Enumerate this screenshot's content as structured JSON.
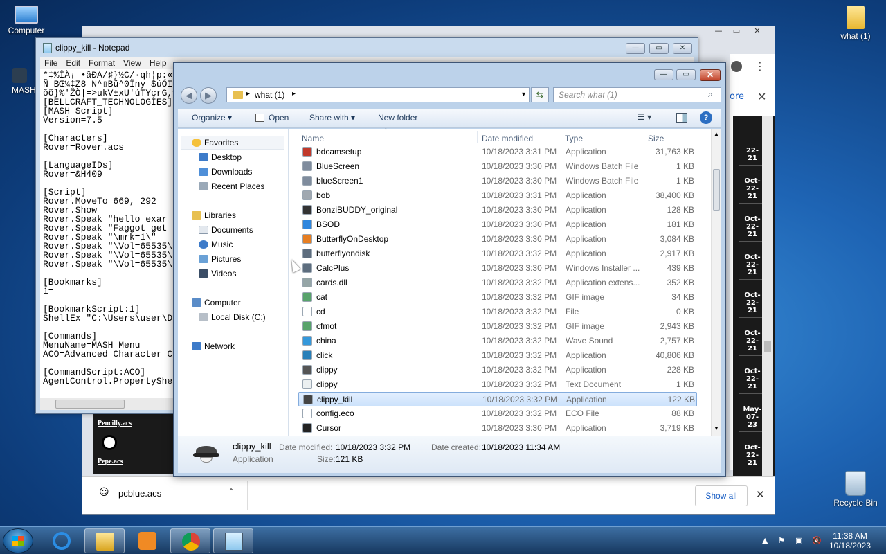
{
  "desktop": {
    "icons": [
      {
        "label": "Computer"
      },
      {
        "label": "MASH"
      },
      {
        "label": "what (1)"
      },
      {
        "label": "Recycle Bin"
      }
    ]
  },
  "browser": {
    "link_text": "ore",
    "dates": [
      "22-\n21",
      "Oct-\n22-\n21",
      "Oct-\n22-\n21",
      "Oct-\n22-\n21",
      "Oct-\n22-\n21",
      "Oct-\n22-\n21",
      "Oct-\n22-\n21",
      "May-\n07-\n23",
      "Oct-\n22-\n21"
    ],
    "acs_items": [
      "Pencilly.acs",
      "Pepe.acs"
    ],
    "download": {
      "filename": "pcblue.acs",
      "show_all": "Show all"
    }
  },
  "notepad": {
    "title": "clippy_kill - Notepad",
    "menu": [
      "File",
      "Edit",
      "Format",
      "View",
      "Help"
    ],
    "lines": [
      "*‡%ÎÀ¡—•âÐA/♯}½C/·qh¦p:«0",
      "Ñ–BŒ¼‡Z8 N^▯Bü^0Ïny $úÓI",
      "ŏõ}%'ŽÒ|=>ukV±xU'úTYçrG,€",
      "[BELLCRAFT_TECHNOLOGIES]",
      "[MASH Script]",
      "Version=7.5",
      "",
      "[Characters]",
      "Rover=Rover.acs",
      "",
      "[LanguageIDs]",
      "Rover=&H409",
      "",
      "[Script]",
      "Rover.MoveTo 669, 292",
      "Rover.Show",
      "Rover.Speak \"hello exar",
      "Rover.Speak \"Faggot get",
      "Rover.Speak \"\\mrk=1\\\"",
      "Rover.Speak \"\\Vol=65535\\",
      "Rover.Speak \"\\Vol=65535\\",
      "Rover.Speak \"\\Vol=65535\\",
      "",
      "[Bookmarks]",
      "1=",
      "",
      "[BookmarkScript:1]",
      "ShellEx \"C:\\Users\\user\\D",
      "",
      "[Commands]",
      "MenuName=MASH Menu",
      "ACO=Advanced Character C",
      "",
      "[CommandScript:ACO]",
      "AgentControl.PropertyShe"
    ]
  },
  "explorer": {
    "breadcrumb": "what (1)",
    "search_placeholder": "Search what (1)",
    "toolbar": {
      "organize": "Organize",
      "open": "Open",
      "share_with": "Share with",
      "new_folder": "New folder"
    },
    "nav": {
      "favorites": "Favorites",
      "favorites_items": [
        "Desktop",
        "Downloads",
        "Recent Places"
      ],
      "libraries": "Libraries",
      "libraries_items": [
        "Documents",
        "Music",
        "Pictures",
        "Videos"
      ],
      "computer": "Computer",
      "computer_items": [
        "Local Disk (C:)"
      ],
      "network": "Network"
    },
    "columns": [
      "Name",
      "Date modified",
      "Type",
      "Size"
    ],
    "files": [
      {
        "name": "bdcamsetup",
        "date": "10/18/2023 3:31 PM",
        "type": "Application",
        "size": "31,763 KB",
        "color": "#c0392b"
      },
      {
        "name": "BlueScreen",
        "date": "10/18/2023 3:30 PM",
        "type": "Windows Batch File",
        "size": "1 KB",
        "color": "#7f8c9d"
      },
      {
        "name": "blueScreen1",
        "date": "10/18/2023 3:30 PM",
        "type": "Windows Batch File",
        "size": "1 KB",
        "color": "#7f8c9d"
      },
      {
        "name": "bob",
        "date": "10/18/2023 3:31 PM",
        "type": "Application",
        "size": "38,400 KB",
        "color": "#a0a8b0"
      },
      {
        "name": "BonziBUDDY_original",
        "date": "10/18/2023 3:30 PM",
        "type": "Application",
        "size": "128 KB",
        "color": "#333333"
      },
      {
        "name": "BSOD",
        "date": "10/18/2023 3:30 PM",
        "type": "Application",
        "size": "181 KB",
        "color": "#2e86de"
      },
      {
        "name": "ButterflyOnDesktop",
        "date": "10/18/2023 3:30 PM",
        "type": "Application",
        "size": "3,084 KB",
        "color": "#e67e22"
      },
      {
        "name": "butterflyondisk",
        "date": "10/18/2023 3:32 PM",
        "type": "Application",
        "size": "2,917 KB",
        "color": "#5d6d7e"
      },
      {
        "name": "CalcPlus",
        "date": "10/18/2023 3:30 PM",
        "type": "Windows Installer ...",
        "size": "439 KB",
        "color": "#5d6d7e"
      },
      {
        "name": "cards.dll",
        "date": "10/18/2023 3:32 PM",
        "type": "Application extens...",
        "size": "352 KB",
        "color": "#95a5a6"
      },
      {
        "name": "cat",
        "date": "10/18/2023 3:32 PM",
        "type": "GIF image",
        "size": "34 KB",
        "color": "#58a36b"
      },
      {
        "name": "cd",
        "date": "10/18/2023 3:32 PM",
        "type": "File",
        "size": "0 KB",
        "color": "#ffffff"
      },
      {
        "name": "cfmot",
        "date": "10/18/2023 3:32 PM",
        "type": "GIF image",
        "size": "2,943 KB",
        "color": "#58a36b"
      },
      {
        "name": "china",
        "date": "10/18/2023 3:32 PM",
        "type": "Wave Sound",
        "size": "2,757 KB",
        "color": "#3498db"
      },
      {
        "name": "click",
        "date": "10/18/2023 3:32 PM",
        "type": "Application",
        "size": "40,806 KB",
        "color": "#2980b9"
      },
      {
        "name": "clippy",
        "date": "10/18/2023 3:32 PM",
        "type": "Application",
        "size": "228 KB",
        "color": "#555555"
      },
      {
        "name": "clippy",
        "date": "10/18/2023 3:32 PM",
        "type": "Text Document",
        "size": "1 KB",
        "color": "#ecf0f1"
      },
      {
        "name": "clippy_kill",
        "date": "10/18/2023 3:32 PM",
        "type": "Application",
        "size": "122 KB",
        "color": "#444444",
        "selected": true
      },
      {
        "name": "config.eco",
        "date": "10/18/2023 3:32 PM",
        "type": "ECO File",
        "size": "88 KB",
        "color": "#ffffff"
      },
      {
        "name": "Cursor",
        "date": "10/18/2023 3:30 PM",
        "type": "Application",
        "size": "3,719 KB",
        "color": "#222222"
      }
    ],
    "details": {
      "name": "clippy_kill",
      "type": "Application",
      "date_modified_label": "Date modified:",
      "date_modified": "10/18/2023 3:32 PM",
      "date_created_label": "Date created:",
      "date_created": "10/18/2023 11:34 AM",
      "size_label": "Size:",
      "size": "121 KB"
    }
  },
  "taskbar": {
    "time": "11:38 AM",
    "date": "10/18/2023"
  }
}
